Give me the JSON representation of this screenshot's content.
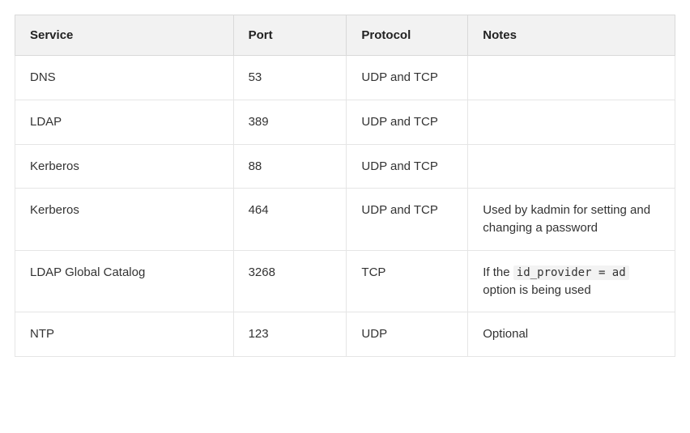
{
  "table": {
    "headers": {
      "service": "Service",
      "port": "Port",
      "protocol": "Protocol",
      "notes": "Notes"
    },
    "rows": [
      {
        "service": "DNS",
        "port": "53",
        "protocol": "UDP and TCP",
        "notes": ""
      },
      {
        "service": "LDAP",
        "port": "389",
        "protocol": "UDP and TCP",
        "notes": ""
      },
      {
        "service": "Kerberos",
        "port": "88",
        "protocol": "UDP and TCP",
        "notes": ""
      },
      {
        "service": "Kerberos",
        "port": "464",
        "protocol": "UDP and TCP",
        "notes": "Used by kadmin for setting and changing a password"
      },
      {
        "service": "LDAP Global Catalog",
        "port": "3268",
        "protocol": "TCP",
        "notes_pre": "If the ",
        "notes_code": "id_provider = ad",
        "notes_post": " option is being used"
      },
      {
        "service": "NTP",
        "port": "123",
        "protocol": "UDP",
        "notes": "Optional"
      }
    ]
  }
}
